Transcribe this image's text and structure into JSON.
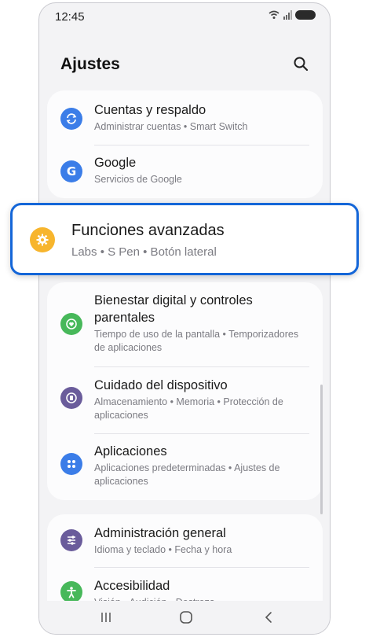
{
  "status_bar": {
    "time": "12:45"
  },
  "header": {
    "title": "Ajustes"
  },
  "items": {
    "cuentas": {
      "title": "Cuentas y respaldo",
      "subtitle": "Administrar cuentas  •  Smart Switch",
      "color": "#3b7de8"
    },
    "google": {
      "title": "Google",
      "subtitle": "Servicios de Google",
      "color": "#3b7de8"
    },
    "funciones": {
      "title": "Funciones avanzadas",
      "subtitle": "Labs  •  S Pen  •  Botón lateral",
      "color": "#f7b52d"
    },
    "bienestar": {
      "title": "Bienestar digital y controles parentales",
      "subtitle": "Tiempo de uso de la pantalla  •  Temporizadores de aplicaciones",
      "color": "#47b85a"
    },
    "cuidado": {
      "title": "Cuidado del dispositivo",
      "subtitle": "Almacenamiento  •  Memoria  •  Protección de aplicaciones",
      "color": "#6a5c9b"
    },
    "aplicaciones": {
      "title": "Aplicaciones",
      "subtitle": "Aplicaciones predeterminadas  •  Ajustes de aplicaciones",
      "color": "#3b7de8"
    },
    "administracion": {
      "title": "Administración general",
      "subtitle": "Idioma y teclado  •  Fecha y hora",
      "color": "#6a5c9b"
    },
    "accesibilidad": {
      "title": "Accesibilidad",
      "subtitle": "Visión  •  Audición  •  Destreza",
      "color": "#47b85a"
    }
  }
}
